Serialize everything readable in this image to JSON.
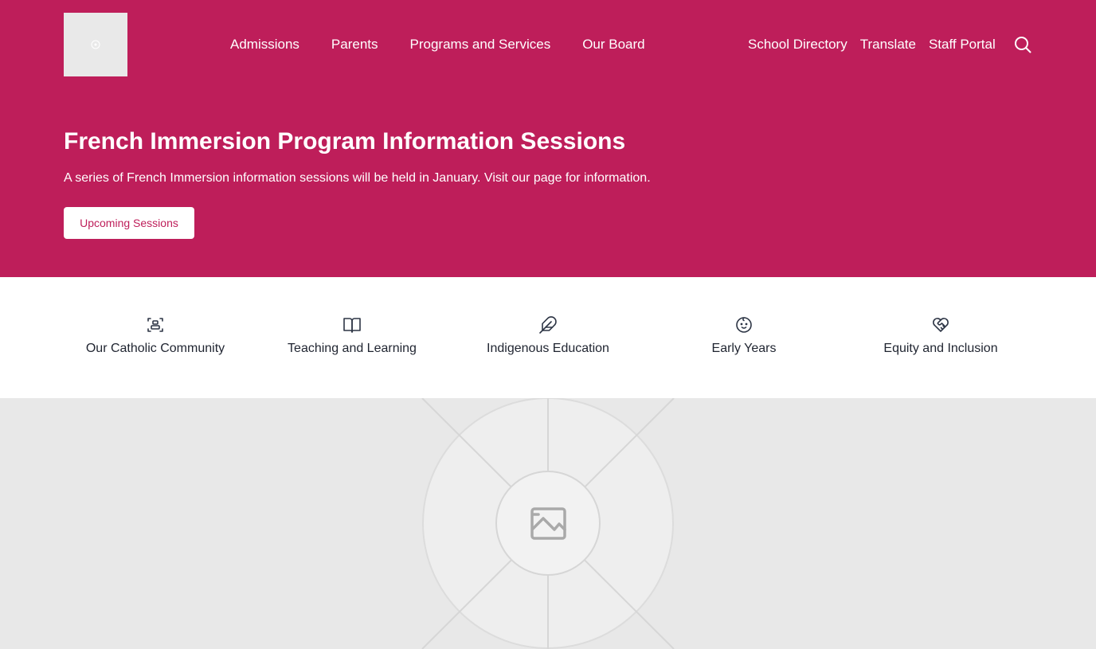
{
  "header": {
    "logo_alt": "logo",
    "main_nav": [
      "Admissions",
      "Parents",
      "Programs and Services",
      "Our Board"
    ],
    "utility_nav": [
      "School Directory",
      "Translate",
      "Staff Portal"
    ],
    "search_icon": "search-icon"
  },
  "hero": {
    "title": "French Immersion Program Information Sessions",
    "text": "A series of French Immersion information sessions will be held in January. Visit our page for information.",
    "button_label": "Upcoming Sessions"
  },
  "quick_links": [
    {
      "label": "Our Catholic Community",
      "icon": "community-icon"
    },
    {
      "label": "Teaching and Learning",
      "icon": "book-icon"
    },
    {
      "label": "Indigenous Education",
      "icon": "feather-icon"
    },
    {
      "label": "Early Years",
      "icon": "baby-face-icon"
    },
    {
      "label": "Equity and Inclusion",
      "icon": "heart-handshake-icon"
    }
  ],
  "image_placeholder": {
    "icon": "image-placeholder-icon"
  },
  "colors": {
    "brand": "#be1e5a",
    "text_dark": "#1f2430",
    "placeholder_bg": "#e8e8e8"
  }
}
